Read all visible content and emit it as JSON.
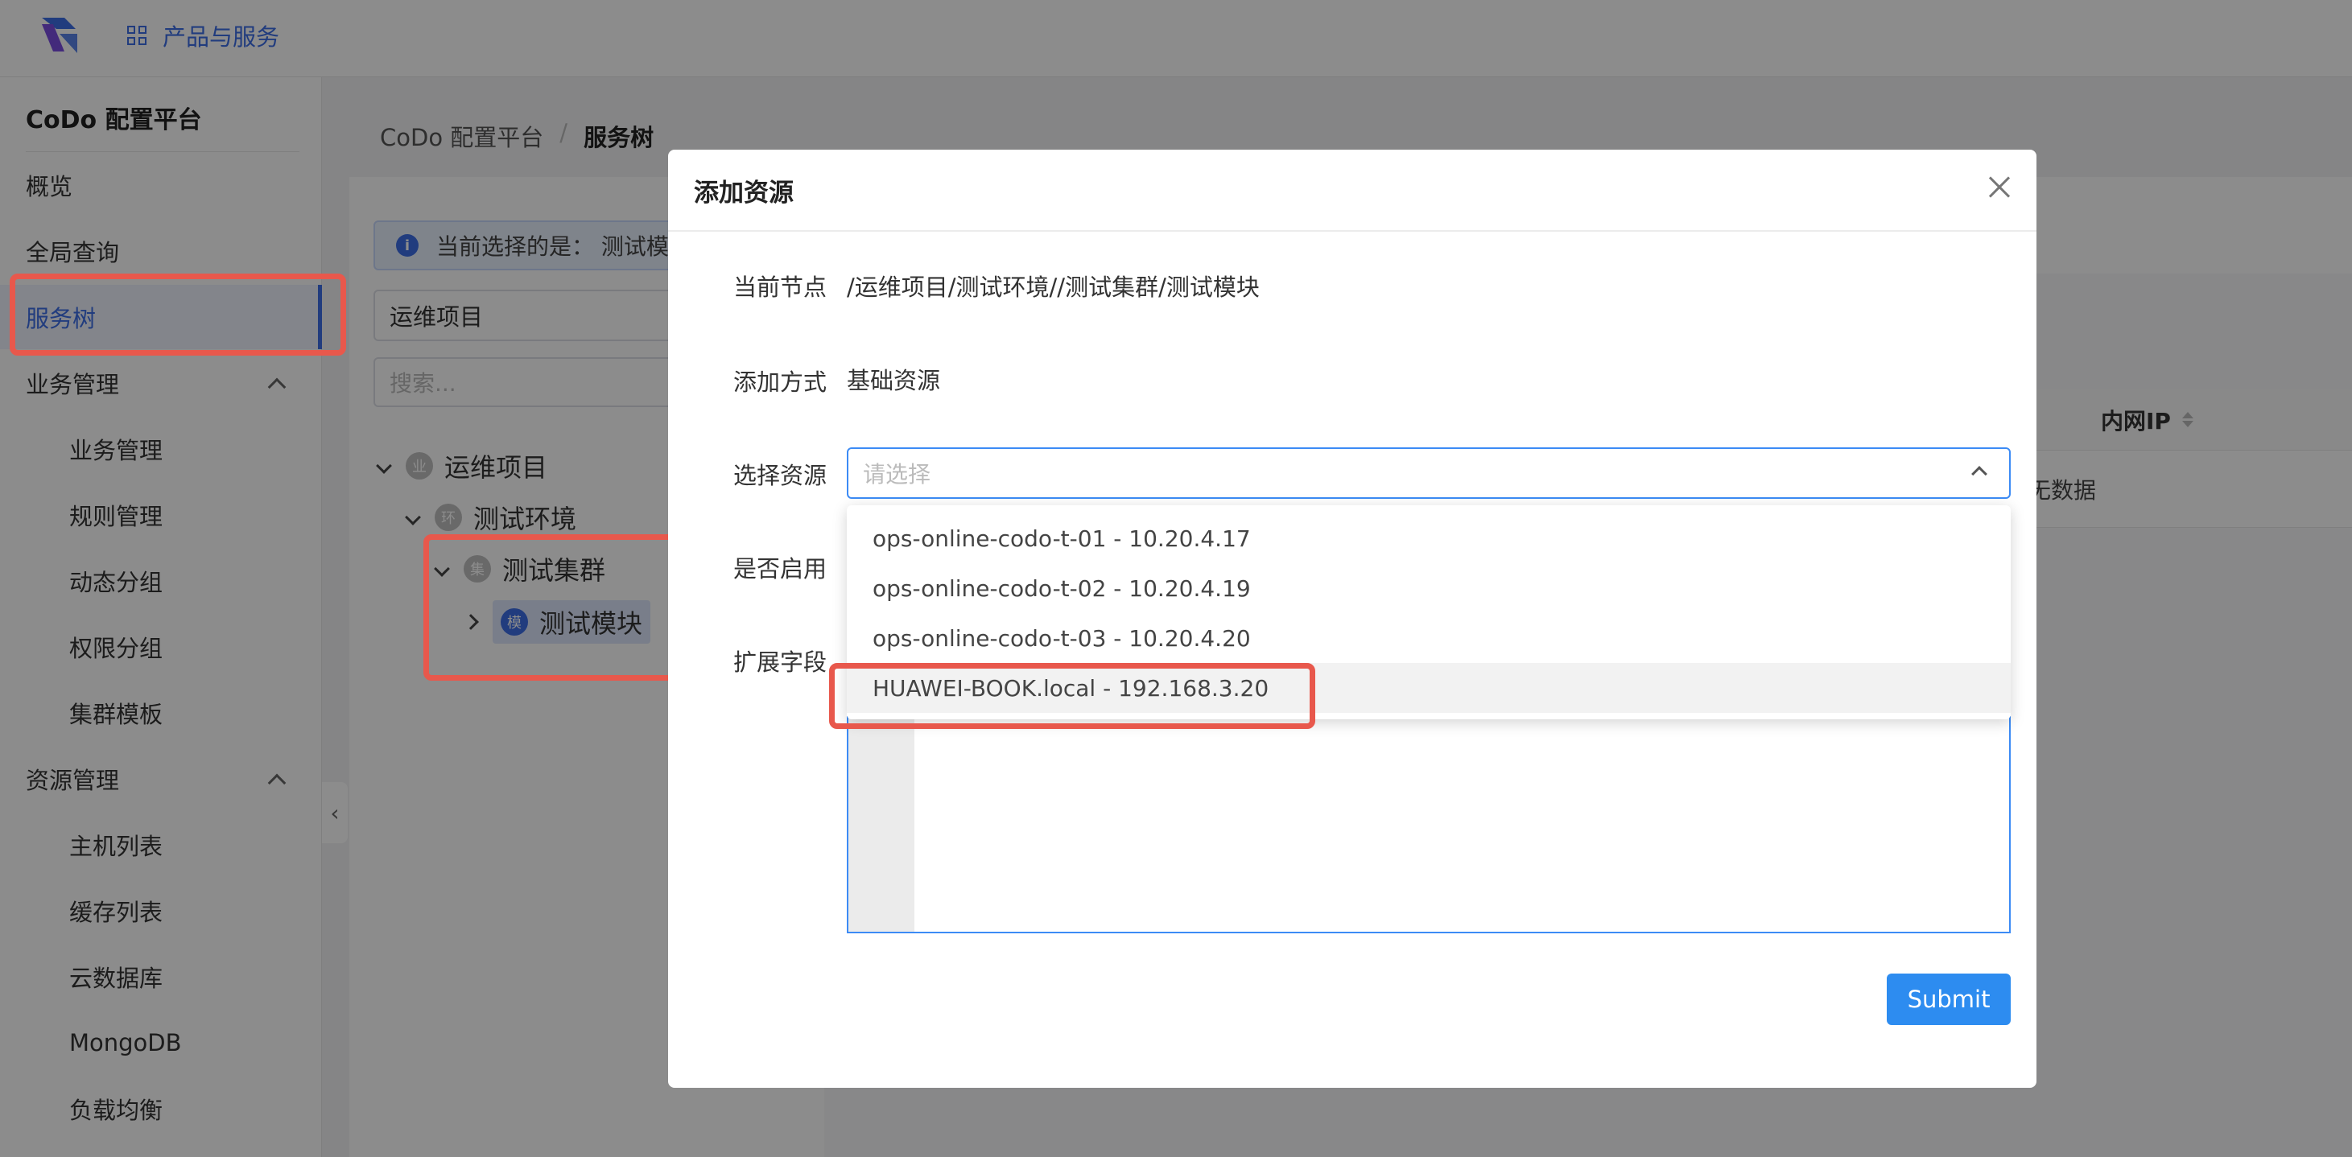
{
  "header": {
    "products_label": "产品与服务"
  },
  "sidebar": {
    "title": "CoDo 配置平台",
    "items": [
      {
        "label": "概览"
      },
      {
        "label": "全局查询"
      },
      {
        "label": "服务树"
      },
      {
        "label": "业务管理"
      },
      {
        "label": "资源管理"
      }
    ],
    "business_sub": [
      "业务管理",
      "规则管理",
      "动态分组",
      "权限分组",
      "集群模板"
    ],
    "resource_sub": [
      "主机列表",
      "缓存列表",
      "云数据库",
      "MongoDB",
      "负载均衡"
    ],
    "active_item": "服务树"
  },
  "breadcrumb": {
    "root": "CoDo 配置平台",
    "sep": "/",
    "current": "服务树"
  },
  "tree_panel": {
    "info_text": "当前选择的是：  测试模块",
    "select_value": "运维项目",
    "search_placeholder": "搜索...",
    "nodes": [
      {
        "label": "运维项目",
        "badge": "业"
      },
      {
        "label": "测试环境",
        "badge": "环"
      },
      {
        "label": "测试集群",
        "badge": "集"
      },
      {
        "label": "测试模块",
        "badge": "模"
      }
    ]
  },
  "table": {
    "col_internal_ip": "内网IP",
    "empty_text": "无数据"
  },
  "modal": {
    "title": "添加资源",
    "fields": {
      "node_label": "当前节点",
      "node_value": "/运维项目/测试环境//测试集群/测试模块",
      "method_label": "添加方式",
      "method_value": "基础资源",
      "resource_label": "选择资源",
      "resource_placeholder": "请选择",
      "enabled_label": "是否启用",
      "ext_label": "扩展字段"
    },
    "options": [
      "ops-online-codo-t-01 - 10.20.4.17",
      "ops-online-codo-t-02 - 10.20.4.19",
      "ops-online-codo-t-03 - 10.20.4.20",
      "HUAWEI-BOOK.local - 192.168.3.20"
    ],
    "submit_label": "Submit"
  },
  "colors": {
    "accent": "#3c6de6",
    "submit": "#2d8cf0",
    "annotation": "#e8584c",
    "focus_border": "#3c8bf5"
  }
}
